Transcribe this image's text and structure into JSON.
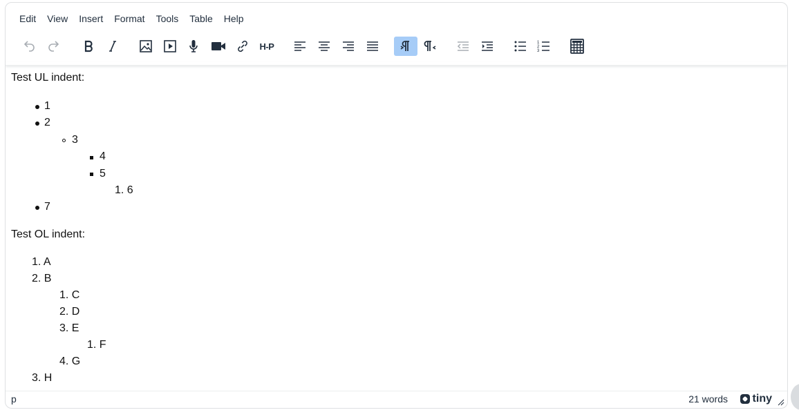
{
  "menubar": [
    "Edit",
    "View",
    "Insert",
    "Format",
    "Tools",
    "Table",
    "Help"
  ],
  "toolbar": {
    "undo": "undo-icon",
    "redo": "redo-icon",
    "bold": "bold-icon",
    "italic": "italic-icon",
    "image": "image-icon",
    "media": "media-icon",
    "mic": "microphone-icon",
    "video": "video-camera-icon",
    "link": "link-icon",
    "h5p": "H-P",
    "ltr_active": true
  },
  "content": {
    "ul_heading": "Test UL indent:",
    "ul_items": [
      "1",
      "2",
      "3",
      "4",
      "5",
      "1. 6",
      "7"
    ],
    "ol_heading": "Test OL indent:",
    "ol_items": [
      "1. A",
      "2. B",
      "1. C",
      "2. D",
      "3. E",
      "1. F",
      "4. G",
      "3. H"
    ]
  },
  "statusbar": {
    "path": "p",
    "wordcount": "21 words",
    "brand": "tiny"
  }
}
